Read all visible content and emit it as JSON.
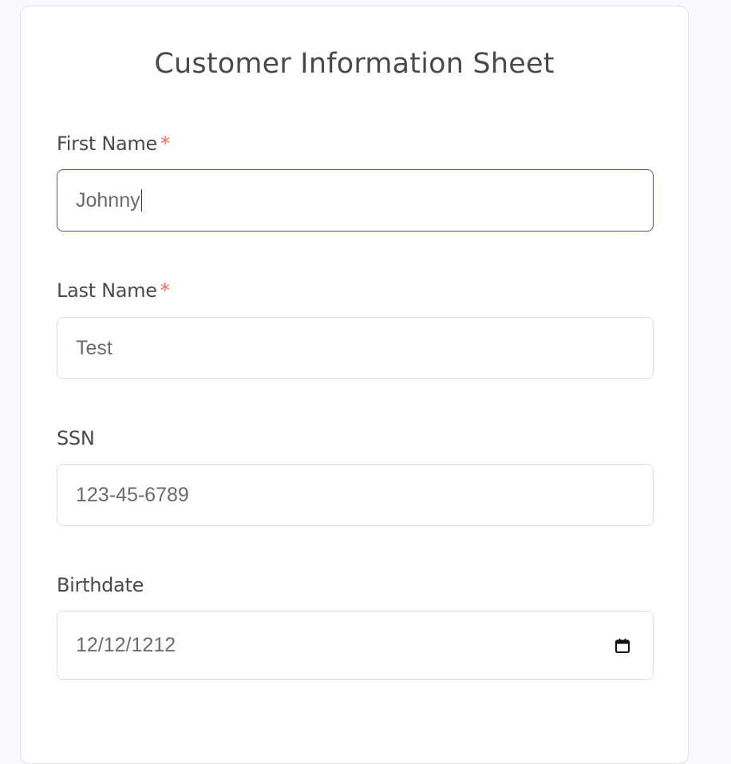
{
  "form": {
    "title": "Customer Information Sheet",
    "required_marker": "*",
    "fields": [
      {
        "label": "First Name",
        "required": true,
        "value": "Johnny",
        "focused": true
      },
      {
        "label": "Last Name",
        "required": true,
        "value": "Test",
        "focused": false
      },
      {
        "label": "SSN",
        "required": false,
        "value": "123-45-6789",
        "focused": false
      },
      {
        "label": "Birthdate",
        "required": false,
        "value": "12/12/1212",
        "focused": false,
        "icon": "calendar-icon"
      }
    ]
  },
  "colors": {
    "required_marker": "#f46a5e",
    "focus_border": "#5b4ba6",
    "page_background": "#f8f9fd"
  }
}
